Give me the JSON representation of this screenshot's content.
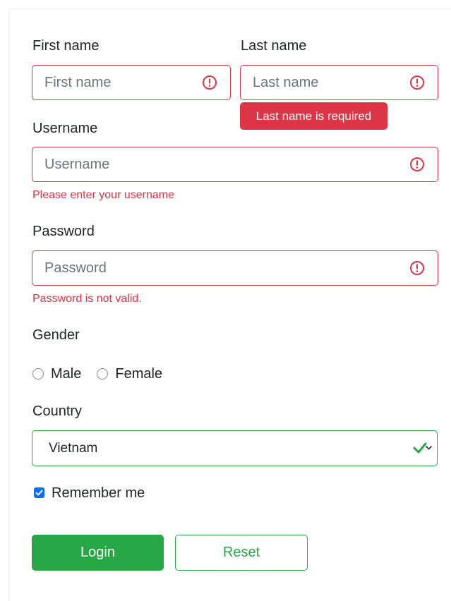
{
  "form": {
    "first_name": {
      "label": "First name",
      "placeholder": "First name",
      "value": ""
    },
    "last_name": {
      "label": "Last name",
      "placeholder": "Last name",
      "value": "",
      "tooltip": "Last name is required"
    },
    "username": {
      "label": "Username",
      "placeholder": "Username",
      "value": "",
      "error": "Please enter your username"
    },
    "password": {
      "label": "Password",
      "placeholder": "Password",
      "value": "",
      "error": "Password is not valid."
    },
    "gender": {
      "label": "Gender",
      "options": [
        "Male",
        "Female"
      ],
      "selected": null
    },
    "country": {
      "label": "Country",
      "selected": "Vietnam"
    },
    "remember_me": {
      "label": "Remember me",
      "checked": true
    },
    "buttons": {
      "login_label": "Login",
      "reset_label": "Reset"
    }
  },
  "colors": {
    "error": "#dc3545",
    "success": "#28a745",
    "checkbox": "#0d6efd",
    "placeholder": "#6c757d"
  },
  "icons": {
    "error": "exclamation-circle-icon",
    "valid": "check-icon",
    "dropdown": "chevron-down-icon",
    "checkbox": "checkmark-icon"
  }
}
